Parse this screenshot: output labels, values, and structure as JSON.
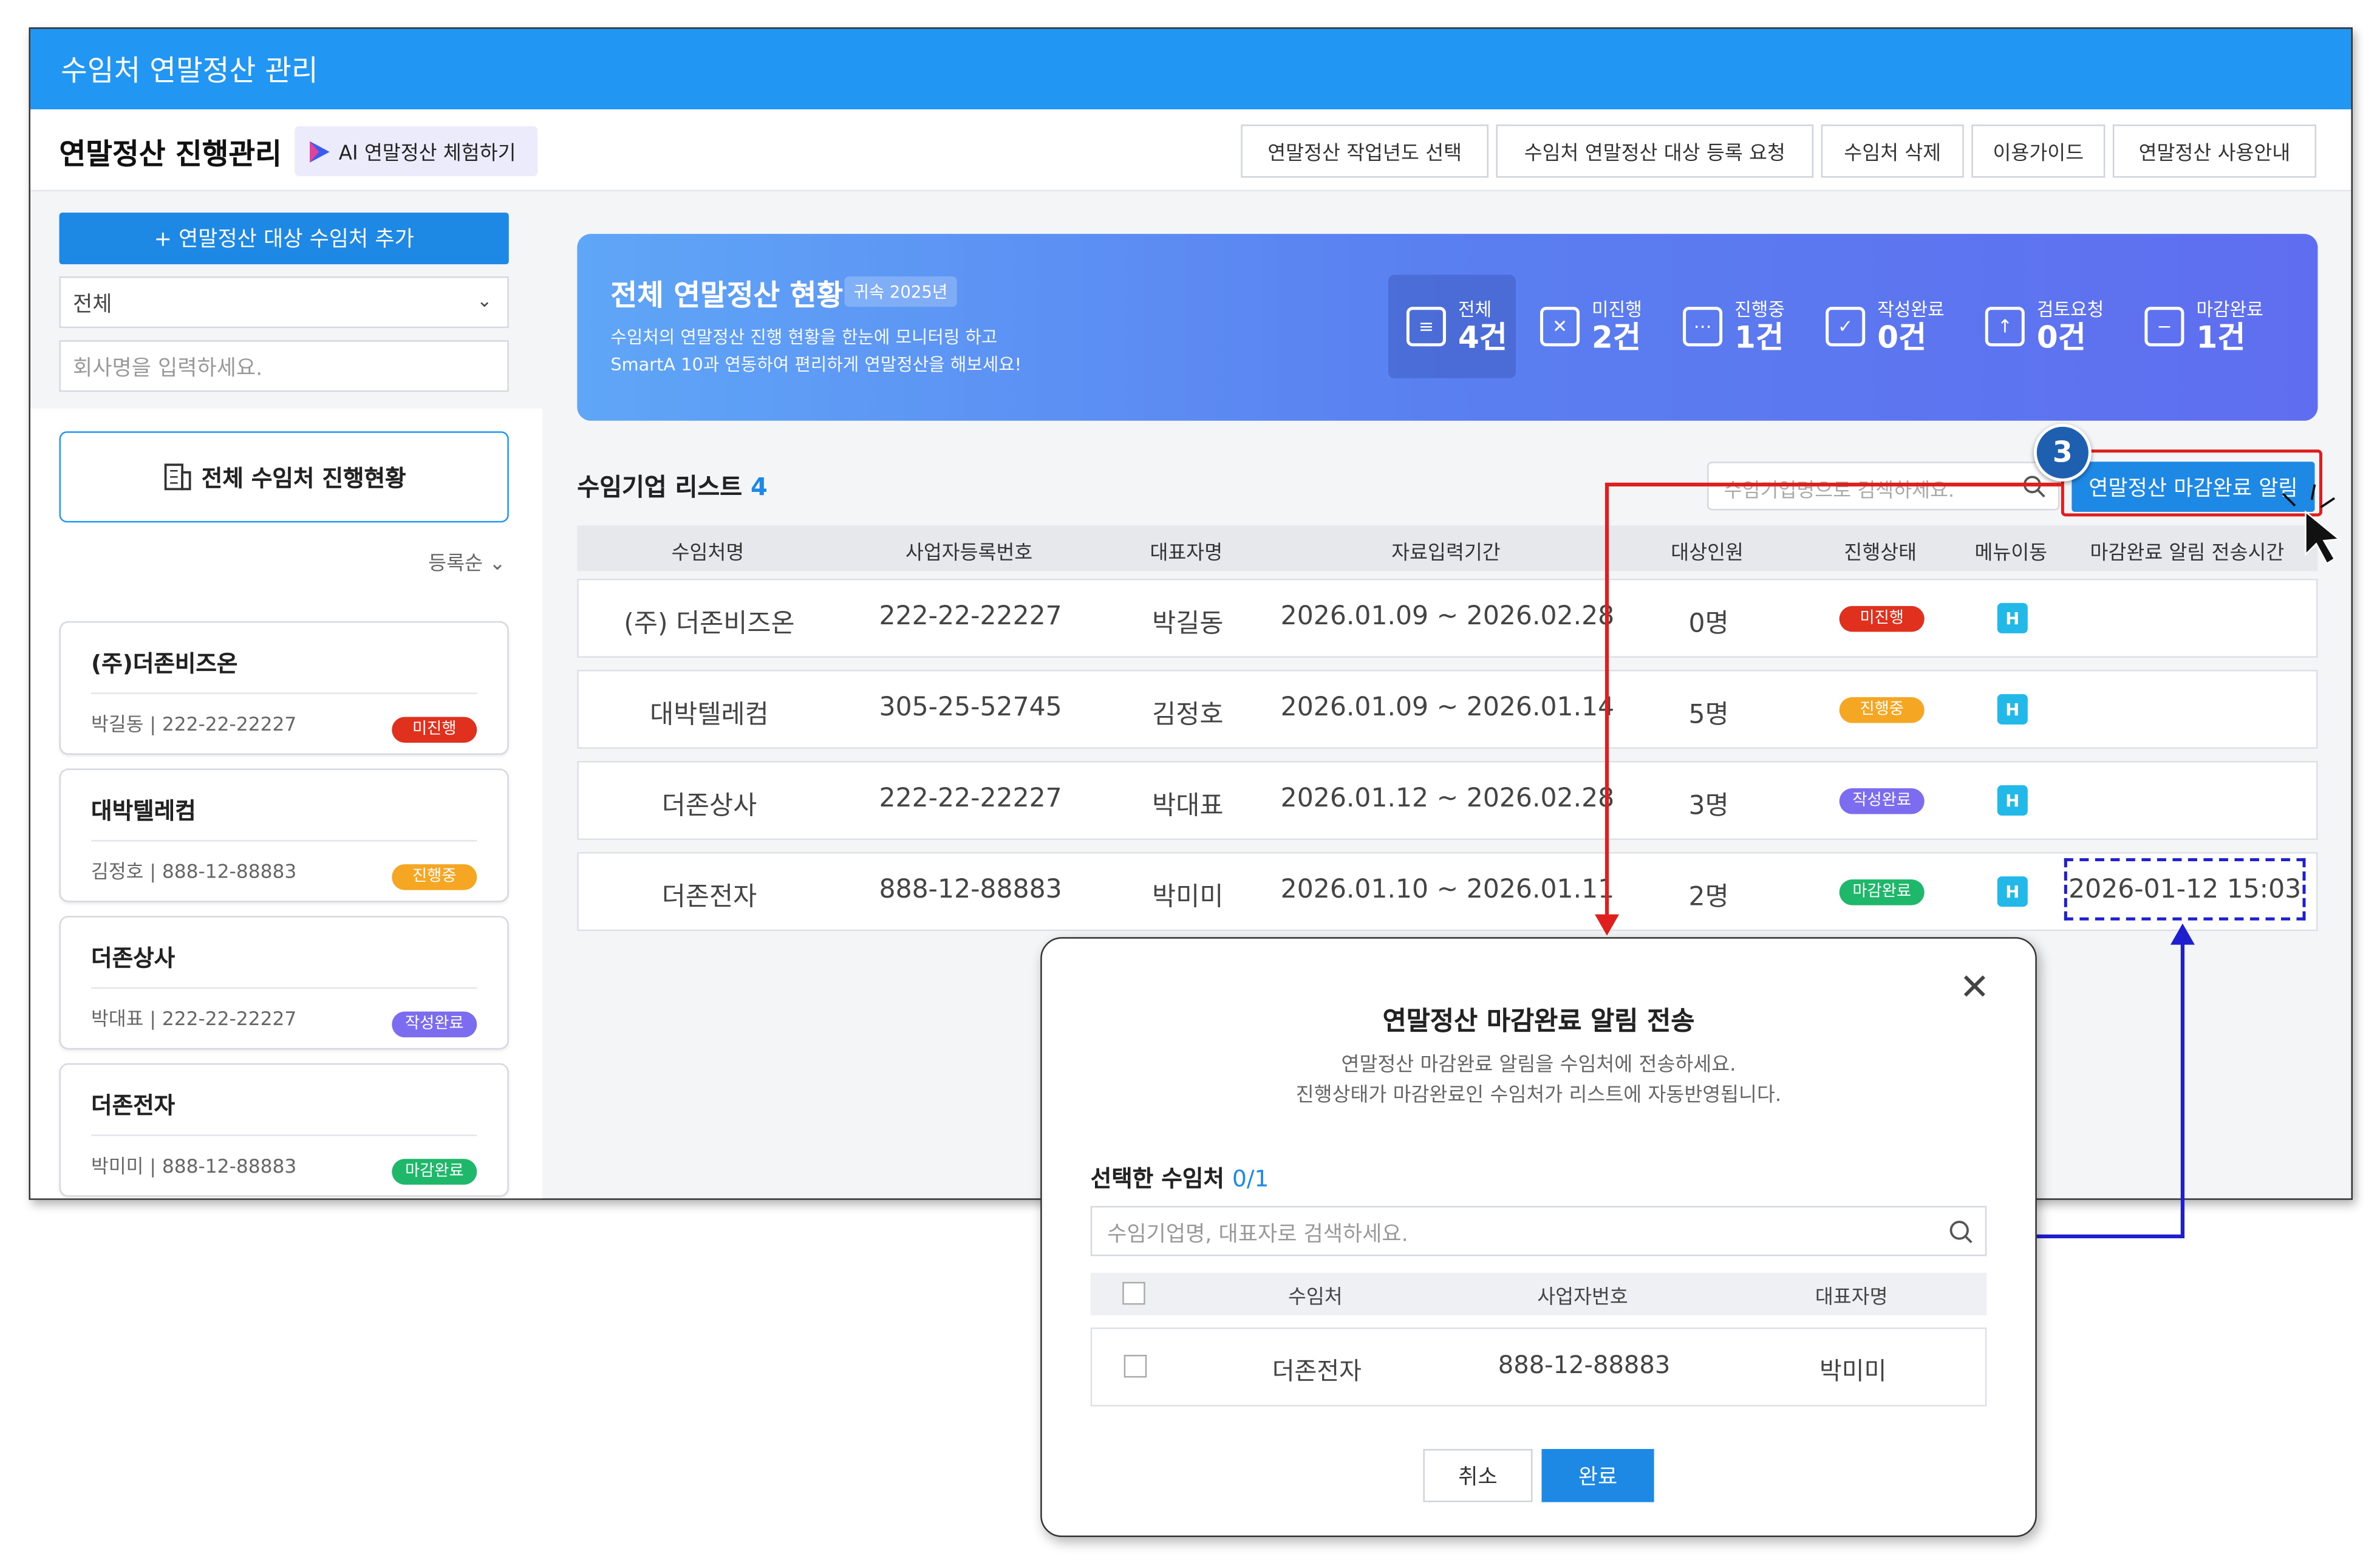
{
  "window": {
    "title": "수임처 연말정산 관리"
  },
  "header": {
    "page_title": "연말정산 진행관리",
    "ai_button": "AI 연말정산 체험하기",
    "buttons": [
      "연말정산 작업년도 선택",
      "수임처 연말정산 대상 등록 요청",
      "수임처 삭제",
      "이용가이드",
      "연말정산 사용안내"
    ]
  },
  "sidebar": {
    "add_button": "+ 연말정산 대상 수임처 추가",
    "filter_value": "전체",
    "search_placeholder": "회사명을 입력하세요.",
    "all_status_button": "전체 수임처 진행현황",
    "sort_label": "등록순",
    "cards": [
      {
        "name": "(주)더존비즈온",
        "ceo": "박길동",
        "bizno": "222-22-22227",
        "status": "미진행"
      },
      {
        "name": "대박텔레컴",
        "ceo": "김정호",
        "bizno": "888-12-88883",
        "status": "진행중"
      },
      {
        "name": "더존상사",
        "ceo": "박대표",
        "bizno": "222-22-22227",
        "status": "작성완료"
      },
      {
        "name": "더존전자",
        "ceo": "박미미",
        "bizno": "888-12-88883",
        "status": "마감완료"
      }
    ]
  },
  "banner": {
    "title": "전체 연말정산 현황",
    "year_chip": "귀속 2025년",
    "desc1": "수임처의 연말정산 진행 현황을 한눈에 모니터링 하고",
    "desc2": "SmartA 10과 연동하여 편리하게 연말정산을 해보세요!",
    "stats": [
      {
        "label": "전체",
        "value": "4건"
      },
      {
        "label": "미진행",
        "value": "2건"
      },
      {
        "label": "진행중",
        "value": "1건"
      },
      {
        "label": "작성완료",
        "value": "0건"
      },
      {
        "label": "검토요청",
        "value": "0건"
      },
      {
        "label": "마감완료",
        "value": "1건"
      }
    ]
  },
  "list": {
    "title": "수임기업 리스트",
    "count": "4",
    "search_placeholder": "수임기업명으로 검색하세요.",
    "notify_button": "연말정산 마감완료 알림",
    "columns": [
      "수임처명",
      "사업자등록번호",
      "대표자명",
      "자료입력기간",
      "대상인원",
      "진행상태",
      "메뉴이동",
      "마감완료 알림 전송시간"
    ],
    "rows": [
      {
        "name": "(주) 더존비즈온",
        "bizno": "222-22-22227",
        "ceo": "박길동",
        "period": "2026.01.09 ~ 2026.02.28",
        "count": "0명",
        "status": "미진행",
        "sent": ""
      },
      {
        "name": "대박텔레컴",
        "bizno": "305-25-52745",
        "ceo": "김정호",
        "period": "2026.01.09 ~ 2026.01.14",
        "count": "5명",
        "status": "진행중",
        "sent": ""
      },
      {
        "name": "더존상사",
        "bizno": "222-22-22227",
        "ceo": "박대표",
        "period": "2026.01.12 ~ 2026.02.28",
        "count": "3명",
        "status": "작성완료",
        "sent": ""
      },
      {
        "name": "더존전자",
        "bizno": "888-12-88883",
        "ceo": "박미미",
        "period": "2026.01.10 ~ 2026.01.11",
        "count": "2명",
        "status": "마감완료",
        "sent": "2026-01-12 15:03"
      }
    ]
  },
  "annotation": {
    "step": "3"
  },
  "modal": {
    "title": "연말정산 마감완료 알림 전송",
    "desc1": "연말정산 마감완료 알림을 수임처에 전송하세요.",
    "desc2": "진행상태가 마감완료인 수임처가 리스트에 자동반영됩니다.",
    "selected_label": "선택한 수임처",
    "selected_count": "0/1",
    "search_placeholder": "수임기업명, 대표자로 검색하세요.",
    "columns": [
      "수임처",
      "사업자번호",
      "대표자명"
    ],
    "rows": [
      {
        "name": "더존전자",
        "bizno": "888-12-88883",
        "ceo": "박미미"
      }
    ],
    "cancel": "취소",
    "ok": "완료"
  },
  "colors": {
    "primary": "#1e88e5",
    "titlebar": "#2196f3",
    "status_not_started": "#e0301e",
    "status_in_progress": "#f5a623",
    "status_written": "#7b6cf0",
    "status_closed": "#1fb86b",
    "annotation_red": "#e01e1e",
    "annotation_blue": "#1f1fd0"
  },
  "icons": [
    "chevron-down-icon",
    "building-icon",
    "search-icon",
    "close-icon",
    "menu-move-icon",
    "cursor-icon",
    "ai-play-icon"
  ]
}
